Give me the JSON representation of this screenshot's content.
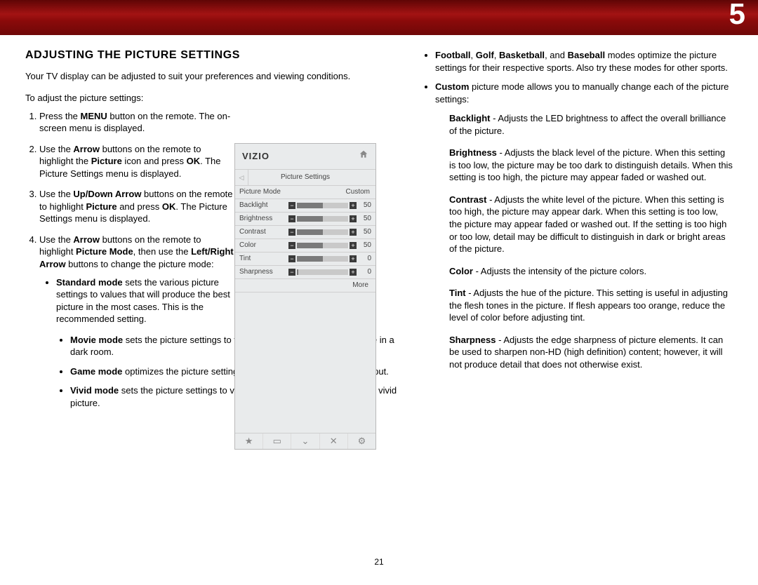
{
  "chapter_number": "5",
  "page_number": "21",
  "heading": "ADJUSTING THE PICTURE SETTINGS",
  "intro": "Your TV display can be adjusted to suit your preferences and viewing conditions.",
  "lead": "To adjust the picture settings:",
  "steps": {
    "s1": {
      "pre": "Press the ",
      "b1": "MENU",
      "post": " button on the remote. The on-screen menu is displayed."
    },
    "s2": {
      "pre": "Use the ",
      "b1": "Arrow",
      "mid": " buttons on the remote to highlight the ",
      "b2": "Picture",
      "post": " icon and press ",
      "b3": "OK",
      "tail": ". The Picture Settings menu is displayed."
    },
    "s3": {
      "pre": "Use the ",
      "b1": "Up/Down Arrow",
      "mid": " buttons on the remote to highlight ",
      "b2": "Picture",
      "mid2": " and press ",
      "b3": "OK",
      "tail": ". The Picture Settings menu is displayed."
    },
    "s4": {
      "pre": "Use the ",
      "b1": "Arrow",
      "mid": " buttons on the remote to highlight ",
      "b2": "Picture Mode",
      "mid2": ", then use the ",
      "b3": "Left/Right Arrow",
      "tail": " buttons to change the picture mode:"
    }
  },
  "modes_narrow": {
    "standard": {
      "b": "Standard mode",
      "rest": " sets the various picture settings to values that will produce the best picture in the most cases. This is the recommended setting."
    }
  },
  "modes_wide": {
    "movie": {
      "b": "Movie mode",
      "rest": " sets the picture settings to values perfect for watching a movie in a dark room."
    },
    "game": {
      "b": "Game mode",
      "rest": " optimizes the picture settings for displaying game console output."
    },
    "vivid": {
      "b": "Vivid mode",
      "rest": " sets the picture settings to values that produce a brighter, more vivid picture."
    }
  },
  "right_bullets": {
    "sports": {
      "b1": "Football",
      "sep1": ", ",
      "b2": "Golf",
      "sep2": ", ",
      "b3": "Basketball",
      "sep3": ", and ",
      "b4": "Baseball",
      "rest": " modes optimize the picture settings for their respective sports. Also try these modes for other sports."
    },
    "custom": {
      "b": "Custom",
      "rest": " picture mode allows you to manually change each of the picture settings:"
    }
  },
  "definitions": {
    "backlight": {
      "b": "Backlight",
      "rest": " - Adjusts the LED brightness to affect the overall brilliance of the picture."
    },
    "brightness": {
      "b": "Brightness",
      "rest": " - Adjusts the black level of the picture. When this setting is too low, the picture may be too dark to distinguish details. When this setting is too high, the picture may appear faded or washed out."
    },
    "contrast": {
      "b": "Contrast",
      "rest": " - Adjusts the white level of the picture. When this setting is too high, the picture may appear dark. When this setting is too low, the picture may appear faded or washed out. If the setting is too high or too low, detail may be difficult to distinguish in dark or bright areas of the picture."
    },
    "color": {
      "b": "Color",
      "rest": " - Adjusts the intensity of the picture colors."
    },
    "tint": {
      "b": "Tint",
      "rest": " - Adjusts the hue of the picture. This setting is useful in adjusting the flesh tones in the picture. If flesh appears too orange, reduce the level of color before adjusting tint."
    },
    "sharpness": {
      "b": "Sharpness",
      "rest": " - Adjusts the edge sharpness of picture elements. It can be used to sharpen non-HD (high definition) content; however, it will not produce detail that does not otherwise exist."
    }
  },
  "osd": {
    "logo": "VIZIO",
    "title": "Picture Settings",
    "picture_mode_label": "Picture Mode",
    "picture_mode_value": "Custom",
    "rows": [
      {
        "label": "Backlight",
        "value": "50",
        "fill": "50%"
      },
      {
        "label": "Brightness",
        "value": "50",
        "fill": "50%"
      },
      {
        "label": "Contrast",
        "value": "50",
        "fill": "50%"
      },
      {
        "label": "Color",
        "value": "50",
        "fill": "50%"
      },
      {
        "label": "Tint",
        "value": "0",
        "fill": "50%"
      },
      {
        "label": "Sharpness",
        "value": "0",
        "fill": "3%"
      }
    ],
    "more_label": "More"
  }
}
